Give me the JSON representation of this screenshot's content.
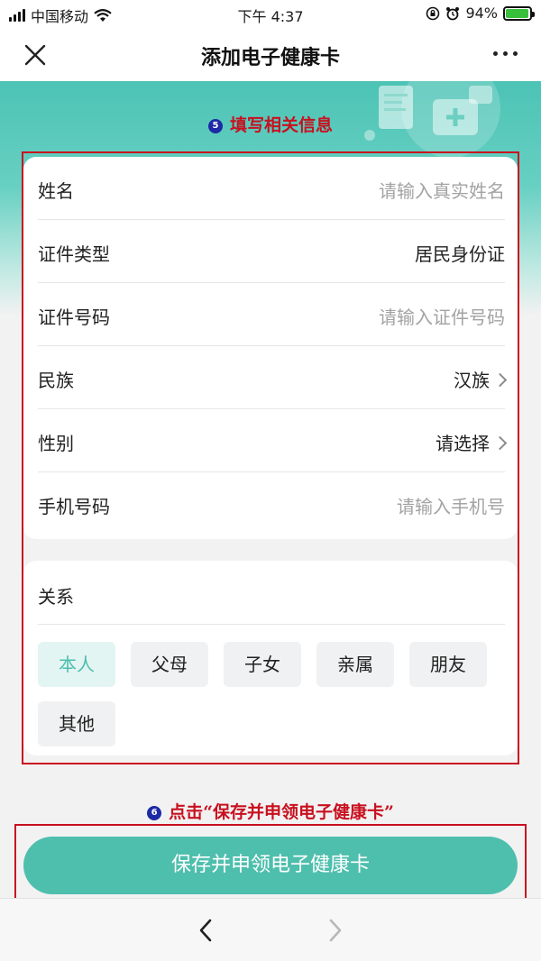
{
  "status_bar": {
    "carrier": "中国移动",
    "time": "下午 4:37",
    "battery_percent": "94%",
    "battery_level": 0.94
  },
  "nav": {
    "title": "添加电子健康卡",
    "close_icon": "close-icon",
    "more_icon": "more-icon"
  },
  "annotations": {
    "step5_number": "5",
    "step5_text": "填写相关信息",
    "step6_number": "6",
    "step6_text": "点击“保存并申领电子健康卡”",
    "color": "#c8101f"
  },
  "form": {
    "rows": [
      {
        "label": "姓名",
        "value": "请输入真实姓名",
        "kind": "placeholder"
      },
      {
        "label": "证件类型",
        "value": "居民身份证",
        "kind": "filled"
      },
      {
        "label": "证件号码",
        "value": "请输入证件号码",
        "kind": "placeholder"
      },
      {
        "label": "民族",
        "value": "汉族",
        "kind": "select"
      },
      {
        "label": "性别",
        "value": "请选择",
        "kind": "select"
      },
      {
        "label": "手机号码",
        "value": "请输入手机号",
        "kind": "placeholder"
      }
    ]
  },
  "relation": {
    "title": "关系",
    "options": [
      "本人",
      "父母",
      "子女",
      "亲属",
      "朋友",
      "其他"
    ],
    "selected": "本人"
  },
  "save_button": {
    "label": "保存并申领电子健康卡"
  },
  "colors": {
    "accent": "#4fbfad",
    "header_teal": "#4cc3b5",
    "chip_active_text": "#4cbfae",
    "placeholder": "#a3a3a3"
  }
}
